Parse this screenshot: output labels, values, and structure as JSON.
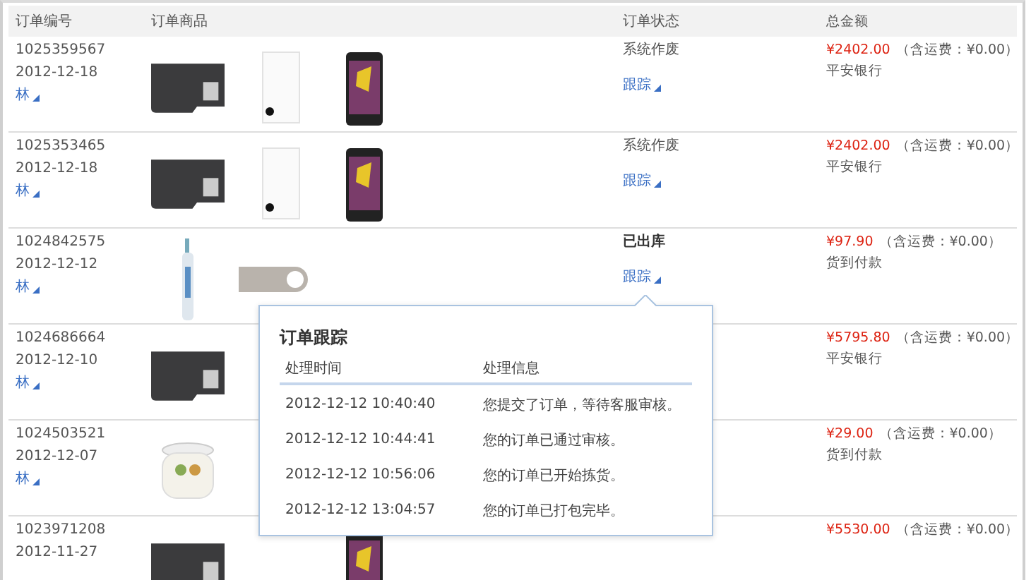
{
  "table": {
    "columns": [
      "订单编号",
      "订单商品",
      "订单状态",
      "总金额"
    ],
    "rows": [
      {
        "order_no": "1025359567",
        "date": "2012-12-18",
        "buyer": "林",
        "products": [
          {
            "kind": "sd-card"
          },
          {
            "kind": "power-bank"
          },
          {
            "kind": "phone"
          }
        ],
        "status": "系统作废",
        "status_bold": false,
        "track": "跟踪",
        "amount": "¥2402.00",
        "shipping": "（含运费：¥0.00）",
        "payment": "平安银行"
      },
      {
        "order_no": "1025353465",
        "date": "2012-12-18",
        "buyer": "林",
        "products": [
          {
            "kind": "sd-card"
          },
          {
            "kind": "power-bank"
          },
          {
            "kind": "phone"
          }
        ],
        "status": "系统作废",
        "status_bold": false,
        "track": "跟踪",
        "amount": "¥2402.00",
        "shipping": "（含运费：¥0.00）",
        "payment": "平安银行"
      },
      {
        "order_no": "1024842575",
        "date": "2012-12-12",
        "buyer": "林",
        "products": [
          {
            "kind": "toothbrush"
          },
          {
            "kind": "usb-drive"
          }
        ],
        "status": "已出库",
        "status_bold": true,
        "track": "跟踪",
        "amount": "¥97.90",
        "shipping": "（含运费：¥0.00）",
        "payment": "货到付款"
      },
      {
        "order_no": "1024686664",
        "date": "2012-12-10",
        "buyer": "林",
        "products": [
          {
            "kind": "sd-card"
          }
        ],
        "amount": "¥5795.80",
        "shipping": "（含运费：¥0.00）",
        "payment": "平安银行"
      },
      {
        "order_no": "1024503521",
        "date": "2012-12-07",
        "buyer": "林",
        "products": [
          {
            "kind": "slow-cooker"
          }
        ],
        "amount": "¥29.00",
        "shipping": "（含运费：¥0.00）",
        "payment": "货到付款"
      },
      {
        "order_no": "1023971208",
        "date": "2012-11-27",
        "products": [
          {
            "kind": "sd-card"
          },
          {
            "kind": "blank"
          },
          {
            "kind": "phone"
          }
        ],
        "amount": "¥5530.00",
        "shipping": "（含运费：¥0.00）"
      }
    ]
  },
  "tracking_popup": {
    "title": "订单跟踪",
    "columns": [
      "处理时间",
      "处理信息"
    ],
    "entries": [
      {
        "time": "2012-12-12 10:40:40",
        "info": "您提交了订单，等待客服审核。"
      },
      {
        "time": "2012-12-12 10:44:41",
        "info": "您的订单已通过审核。"
      },
      {
        "time": "2012-12-12 10:56:06",
        "info": "您的订单已开始拣货。"
      },
      {
        "time": "2012-12-12 13:04:57",
        "info": "您的订单已打包完毕。"
      }
    ]
  }
}
